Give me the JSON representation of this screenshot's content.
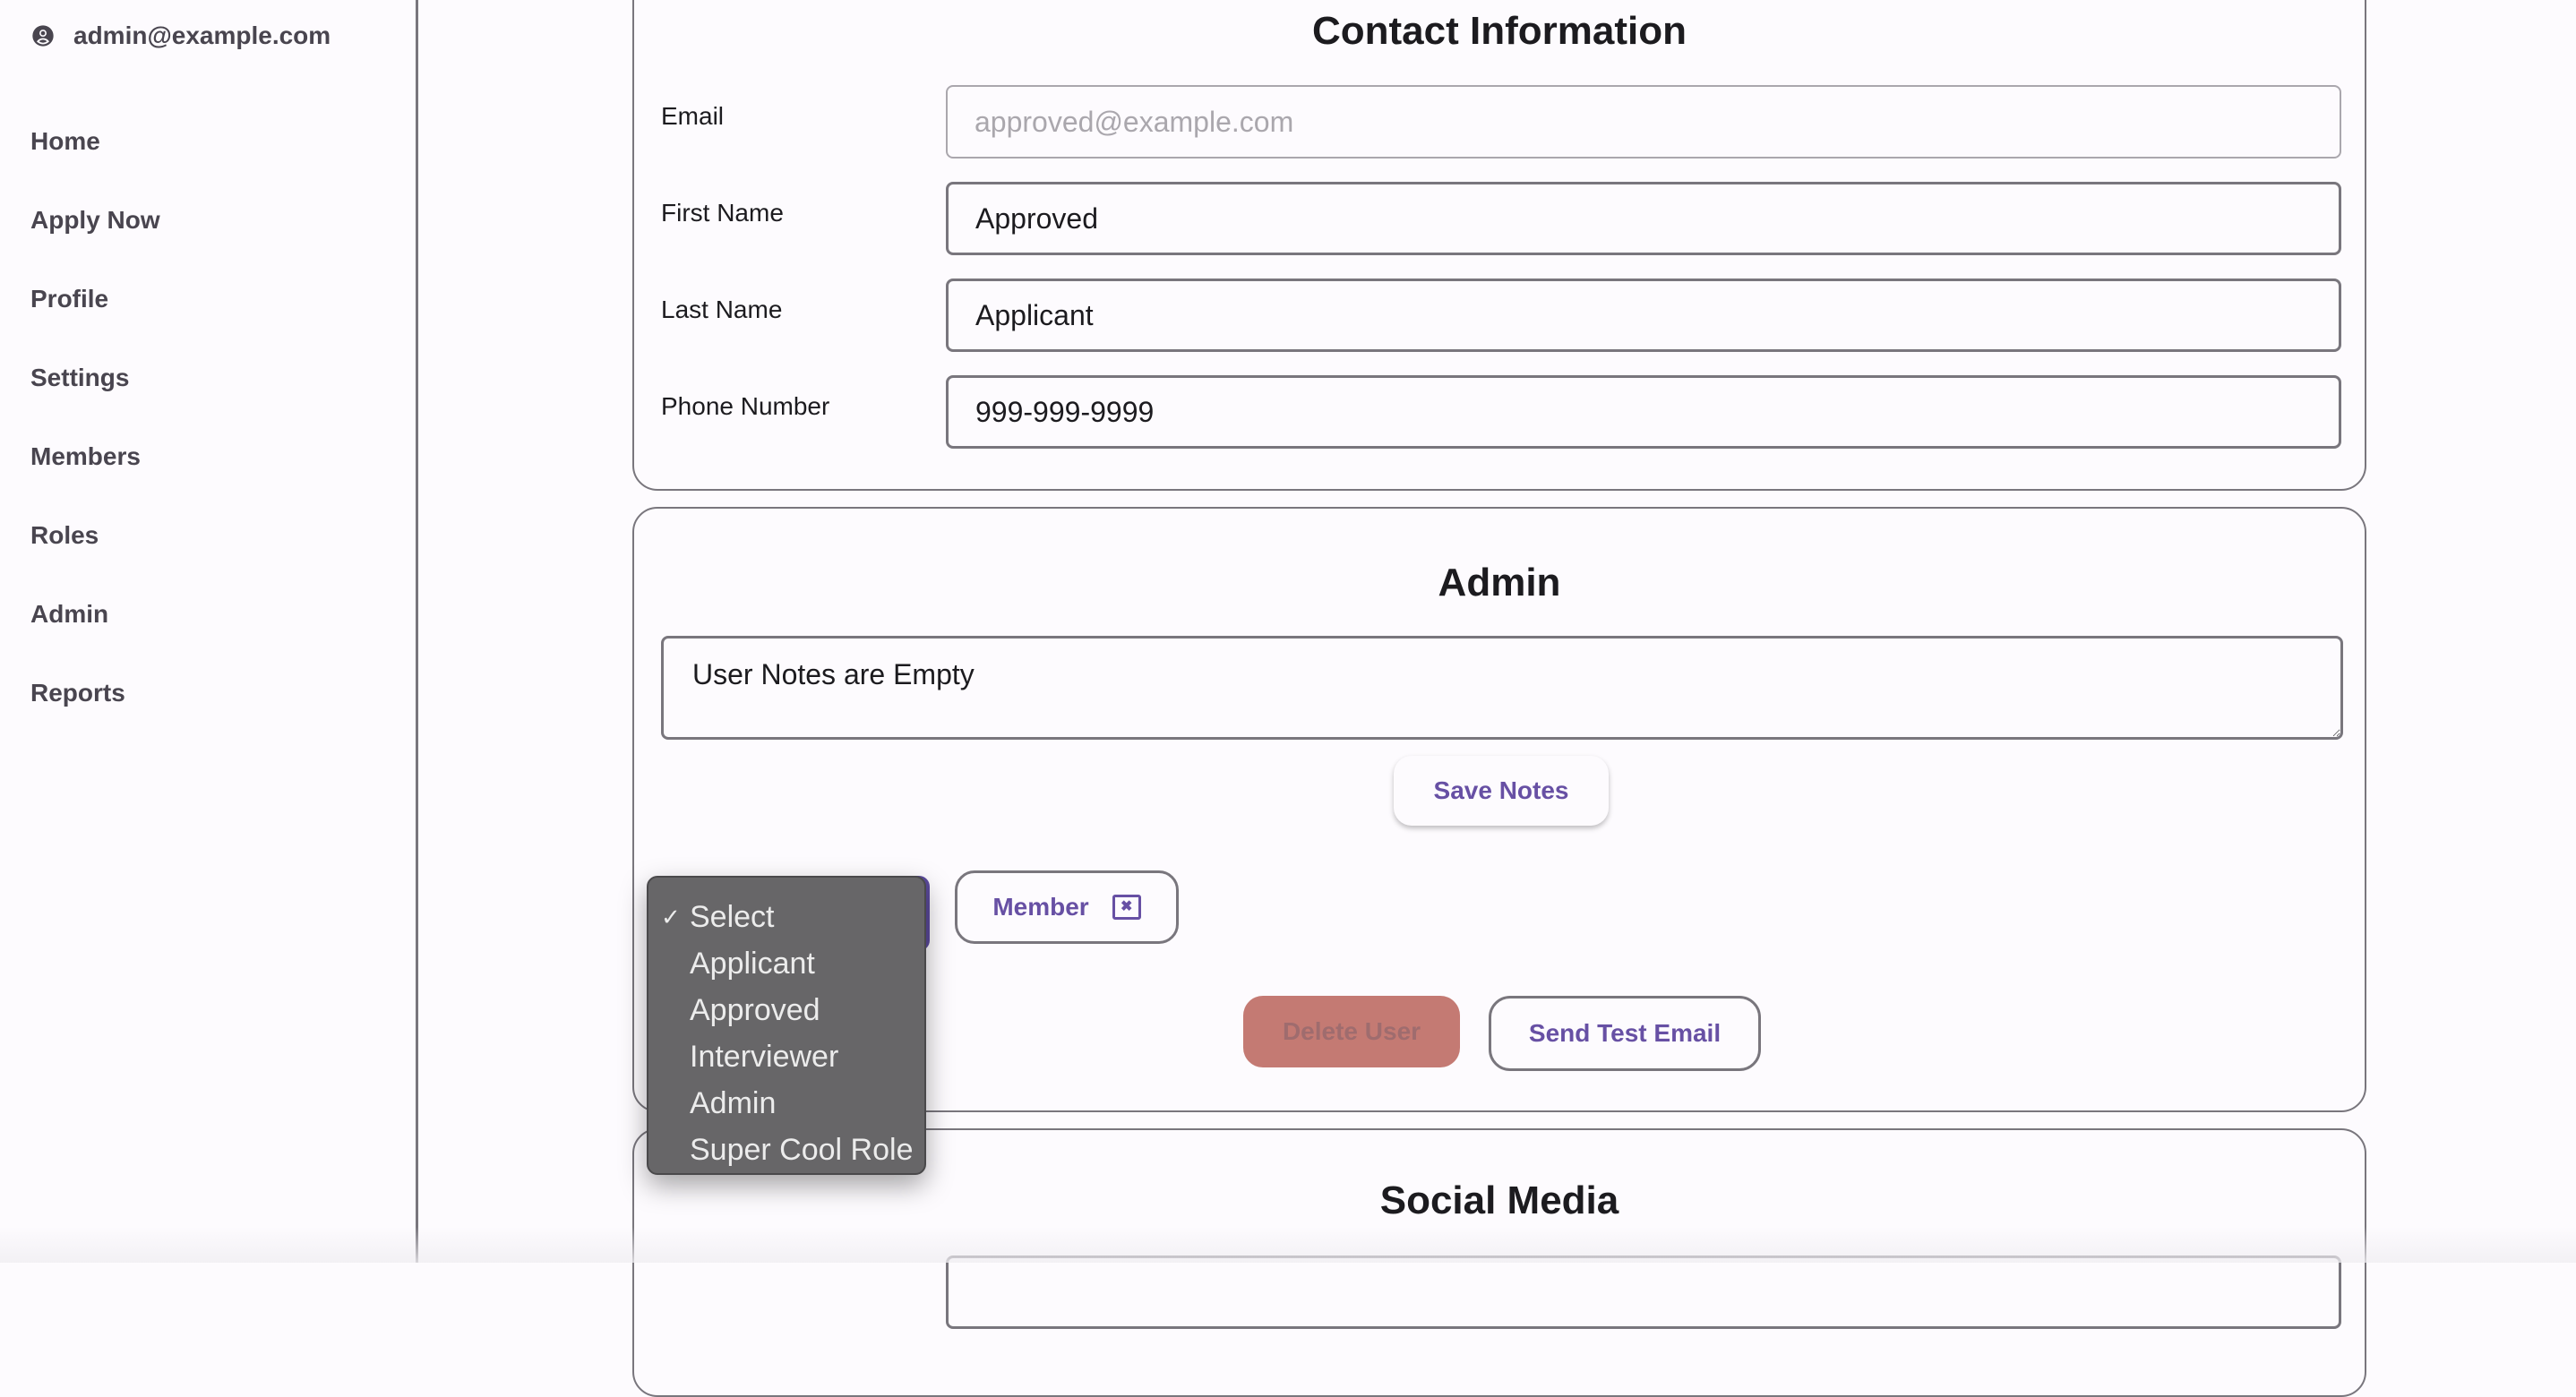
{
  "sidebar": {
    "user_email": "admin@example.com",
    "items": [
      {
        "label": "Home"
      },
      {
        "label": "Apply Now"
      },
      {
        "label": "Profile"
      },
      {
        "label": "Settings"
      },
      {
        "label": "Members"
      },
      {
        "label": "Roles"
      },
      {
        "label": "Admin"
      },
      {
        "label": "Reports"
      }
    ]
  },
  "contact": {
    "title": "Contact Information",
    "fields": [
      {
        "label": "Email",
        "value": "",
        "placeholder": "approved@example.com"
      },
      {
        "label": "First Name",
        "value": "Approved"
      },
      {
        "label": "Last Name",
        "value": "Applicant"
      },
      {
        "label": "Phone Number",
        "value": "999-999-9999"
      }
    ]
  },
  "admin": {
    "title": "Admin",
    "notes_value": "User Notes are Empty",
    "save_notes_label": "Save Notes",
    "role_select": {
      "selected": "Select",
      "options": [
        "Select",
        "Applicant",
        "Approved",
        "Interviewer",
        "Admin",
        "Super Cool Role"
      ]
    },
    "role_chip": {
      "label": "Member"
    },
    "delete_user_label": "Delete User",
    "send_test_email_label": "Send Test Email"
  },
  "social": {
    "title": "Social Media"
  },
  "colors": {
    "accent": "#6750a4",
    "danger_disabled": "#c47a73",
    "border": "#79767d",
    "background": "#fdfbfe"
  }
}
